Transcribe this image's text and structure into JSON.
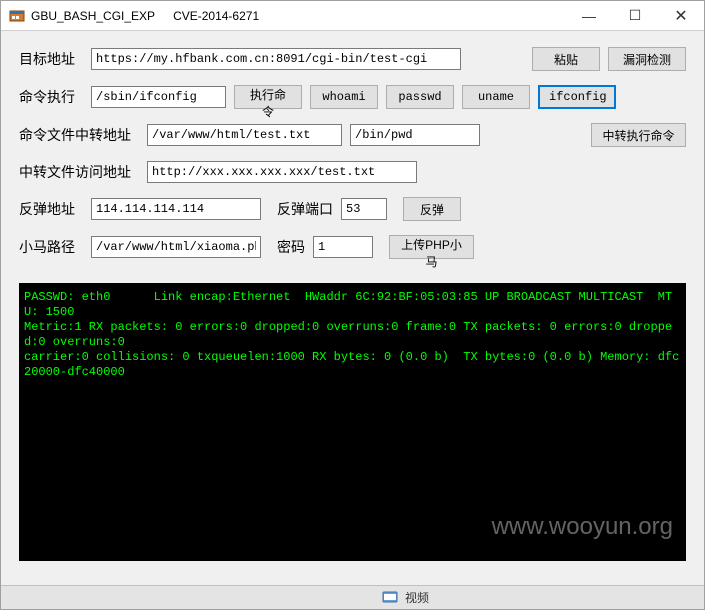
{
  "titlebar": {
    "app_name": "GBU_BASH_CGI_EXP",
    "cve": "CVE-2014-6271"
  },
  "labels": {
    "target_url": "目标地址",
    "cmd_exec": "命令执行",
    "cmd_file_relay": "命令文件中转地址",
    "relay_file_access": "中转文件访问地址",
    "rebound_addr": "反弹地址",
    "rebound_port": "反弹端口",
    "xiaoma_path": "小马路径",
    "password": "密码"
  },
  "buttons": {
    "paste": "粘贴",
    "vuln_detect": "漏洞检测",
    "exec_cmd": "执行命令",
    "whoami": "whoami",
    "passwd": "passwd",
    "uname": "uname",
    "ifconfig": "ifconfig",
    "relay_exec_cmd": "中转执行命令",
    "rebound": "反弹",
    "upload_php": "上传PHP小马"
  },
  "values": {
    "target_url": "https://my.hfbank.com.cn:8091/cgi-bin/test-cgi",
    "cmd": "/sbin/ifconfig",
    "relay_path": "/var/www/html/test.txt",
    "relay_exec": "/bin/pwd",
    "relay_access_url": "http://xxx.xxx.xxx.xxx/test.txt",
    "rebound_ip": "114.114.114.114",
    "rebound_port": "53",
    "xiaoma": "/var/www/html/xiaoma.php",
    "password": "1"
  },
  "console": {
    "line1": "PASSWD: eth0      Link encap:Ethernet  HWaddr 6C:92:BF:05:03:85 UP BROADCAST MULTICAST  MTU: 1500",
    "line2": "Metric:1 RX packets: 0 errors:0 dropped:0 overruns:0 frame:0 TX packets: 0 errors:0 dropped:0 overruns:0",
    "line3": "carrier:0 collisions: 0 txqueuelen:1000 RX bytes: 0 (0.0 b)  TX bytes:0 (0.0 b) Memory: dfc20000-dfc40000"
  },
  "watermark": "www.wooyun.org",
  "bottombar": {
    "label": "视频"
  }
}
